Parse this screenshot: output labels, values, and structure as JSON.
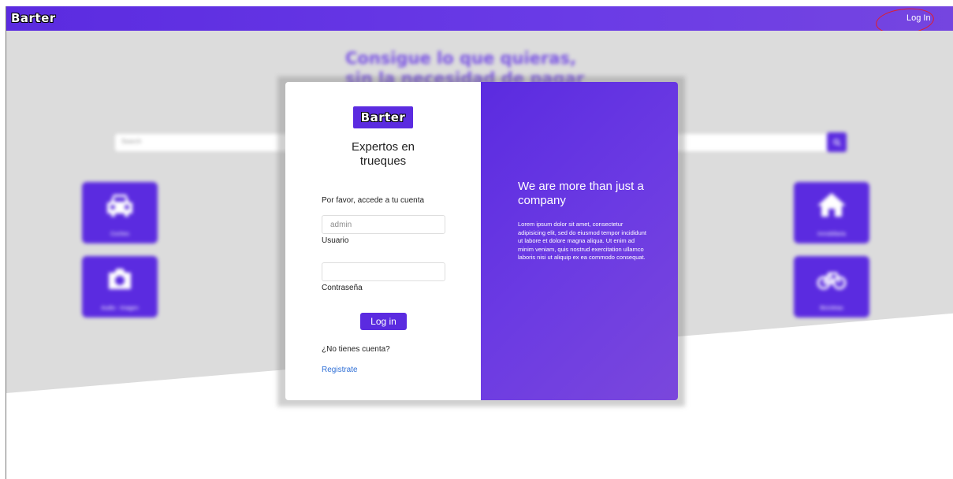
{
  "navbar": {
    "brand": "Barter",
    "login_label": "Log In"
  },
  "background": {
    "hero_title_line1": "Consigue lo que quieras,",
    "hero_title_line2": "sin la necesidad de pagar",
    "search_placeholder": "Search",
    "categories": [
      {
        "label": "Coches",
        "icon": "car-icon"
      },
      {
        "label": "Audio - Imagen",
        "icon": "camera-icon"
      },
      {
        "label": "Inmobiliaria",
        "icon": "home-icon"
      },
      {
        "label": "Bicicletas",
        "icon": "bicycle-icon"
      }
    ]
  },
  "modal": {
    "logo": "Barter",
    "tagline": "Expertos en trueques",
    "prompt": "Por favor, accede a tu cuenta",
    "username": {
      "placeholder": "admin",
      "label": "Usuario"
    },
    "password": {
      "placeholder": "",
      "label": "Contraseña"
    },
    "login_button": "Log in",
    "no_account": "¿No tienes cuenta?",
    "register_link": "Registrate",
    "right_title": "We are more than just a company",
    "right_body": "Lorem ipsum dolor sit amet, consectetur adipisicing elit, sed do eiusmod tempor incididunt ut labore et dolore magna aliqua. Ut enim ad minim veniam, quis nostrud exercitation ullamco laboris nisi ut aliquip ex ea commodo consequat."
  },
  "colors": {
    "primary": "#5b2be0",
    "link": "#2f6fd6",
    "annotation": "#e11d2a"
  }
}
